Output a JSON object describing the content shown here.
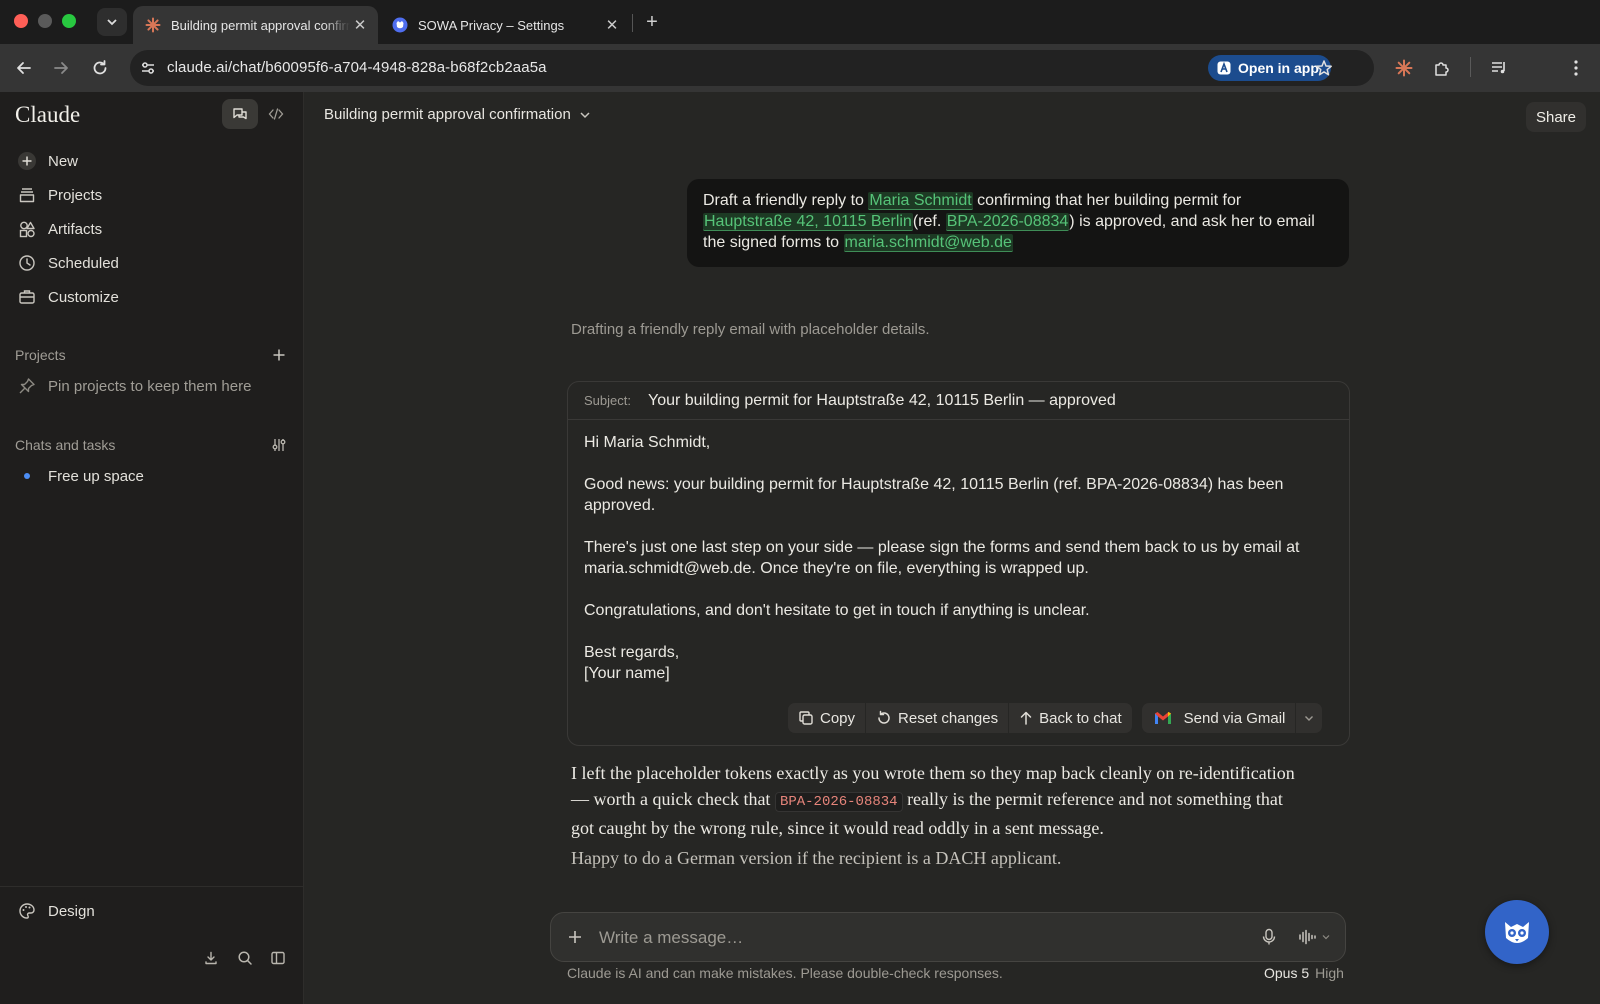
{
  "browser": {
    "tabs": [
      {
        "title": "Building permit approval confirmation",
        "favicon": "claude-favicon-icon"
      },
      {
        "title": "SOWA Privacy – Settings",
        "favicon": "sowa-favicon-icon"
      }
    ],
    "url": "claude.ai/chat/b60095f6-a704-4948-828a-b68f2cb2aa5a",
    "open_in_app_label": "Open in app",
    "accent": "#1c4c8e"
  },
  "sidebar": {
    "logo": "Claude",
    "nav": [
      {
        "label": "New",
        "icon": "plus-icon"
      },
      {
        "label": "Projects",
        "icon": "folder-icon"
      },
      {
        "label": "Artifacts",
        "icon": "shapes-icon"
      },
      {
        "label": "Scheduled",
        "icon": "clock-icon"
      },
      {
        "label": "Customize",
        "icon": "briefcase-icon"
      }
    ],
    "projects_label": "Projects",
    "pin_hint": "Pin projects to keep them here",
    "chats_label": "Chats and tasks",
    "chats": [
      {
        "label": "Free up space"
      }
    ],
    "design_label": "Design"
  },
  "main": {
    "chat_title": "Building permit approval confirmation",
    "share_label": "Share",
    "user_message": {
      "t1": "Draft a friendly reply to ",
      "name": "Maria Schmidt",
      "t2": " confirming that her building permit for ",
      "address": "Hauptstraße 42, 10115 Berlin",
      "t3": "(ref. ",
      "ref": "BPA-2026-08834",
      "t4": ") is approved, and ask her to email the signed forms to ",
      "email": "maria.schmidt@web.de"
    },
    "status_line": "Drafting a friendly reply email with placeholder details.",
    "email": {
      "subject_label": "Subject:",
      "subject": "Your building permit for Hauptstraße 42, 10115 Berlin — approved",
      "greeting": "Hi Maria Schmidt,",
      "p1": "Good news: your building permit for Hauptstraße 42, 10115 Berlin (ref. BPA-2026-08834) has been approved.",
      "p2": "There's just one last step on your side — please sign the forms and send them back to us by email at maria.schmidt@web.de. Once they're on file, everything is wrapped up.",
      "p3": "Congratulations, and don't hesitate to get in touch if anything is unclear.",
      "signoff": "Best regards,",
      "signature": "[Your name]",
      "actions": {
        "copy": "Copy",
        "reset": "Reset changes",
        "back": "Back to chat",
        "send": "Send via Gmail"
      }
    },
    "assistant": {
      "a1": "I left the placeholder tokens exactly as you wrote them so they map back cleanly on re-identification — worth a quick check that ",
      "code": "BPA-2026-08834",
      "a2": " really is the permit reference and not something that got caught by the wrong rule, since it would read oddly in a sent message.",
      "a3": "Happy to do a German version if the recipient is a DACH applicant."
    },
    "composer_placeholder": "Write a message…",
    "disclaimer": "Claude is AI and can make mistakes. Please double-check responses.",
    "model": "Opus 5",
    "effort": "High",
    "highlight_color": "#56c378"
  }
}
